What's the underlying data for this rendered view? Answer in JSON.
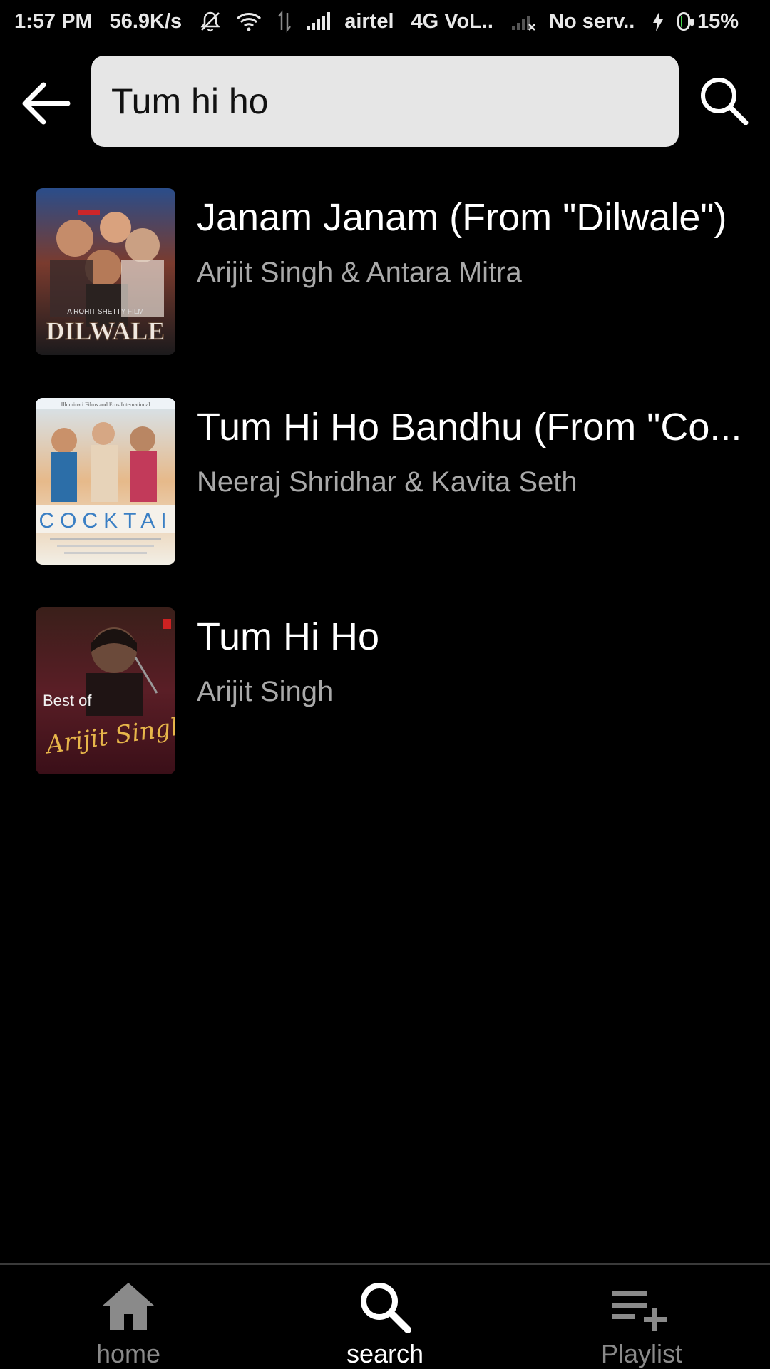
{
  "status_bar": {
    "time": "1:57 PM",
    "speed": "56.9K/s",
    "carrier": "airtel",
    "network": "4G VoL..",
    "no_service": "No serv..",
    "battery": "15%",
    "battery_level": 0.15
  },
  "search": {
    "query": "Tum hi ho"
  },
  "results": [
    {
      "title": "Janam Janam (From \"Dilwale\")",
      "artist": "Arijit Singh & Antara Mitra",
      "art_text": "DILWALE",
      "art_subtext": "A ROHIT SHETTY FILM"
    },
    {
      "title": "Tum Hi Ho Bandhu (From \"Co...",
      "artist": "Neeraj Shridhar & Kavita Seth",
      "art_text": "COCKTAI",
      "art_subtext": "Illuminati Films and Eros International"
    },
    {
      "title": "Tum Hi Ho",
      "artist": "Arijit Singh",
      "art_text_top": "Best of",
      "art_text": "Arijit Singh"
    }
  ],
  "bottom_nav": {
    "items": [
      {
        "label": "home",
        "icon": "home-icon",
        "active": false
      },
      {
        "label": "search",
        "icon": "search-icon",
        "active": true
      },
      {
        "label": "Playlist",
        "icon": "playlist-add-icon",
        "active": false
      }
    ],
    "active_color": "#ffffff",
    "inactive_color": "#8a8a8a"
  }
}
